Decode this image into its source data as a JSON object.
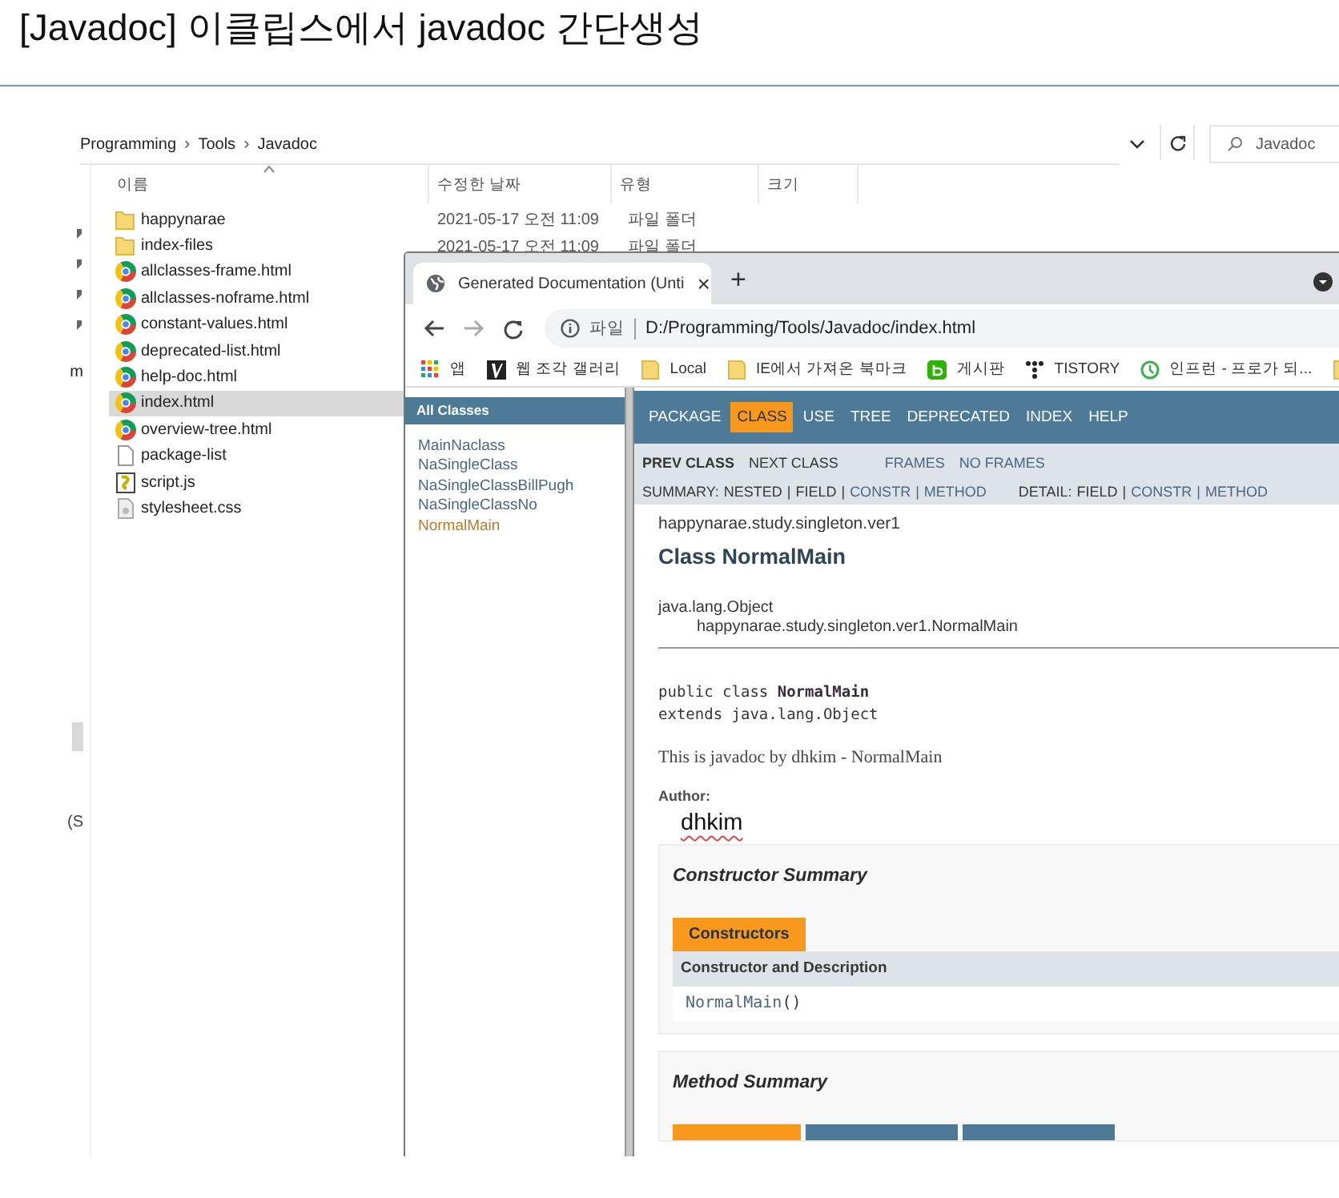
{
  "post_title": "[Javadoc] 이클립스에서 javadoc 간단생성",
  "explorer": {
    "breadcrumb": [
      "Programming",
      "Tools",
      "Javadoc"
    ],
    "breadcrumb_separator": "›",
    "search": {
      "placeholder": "Javadoc"
    },
    "nav_fragments": [
      "m",
      "(S"
    ],
    "columns": [
      "이름",
      "수정한 날짜",
      "유형",
      "크기"
    ],
    "files": [
      {
        "name": "happynarae",
        "kind": "folder",
        "modified": "2021-05-17 오전 11:09",
        "type": "파일 폴더",
        "selected": false
      },
      {
        "name": "index-files",
        "kind": "folder",
        "modified": "2021-05-17 오전 11:09",
        "type": "파일 폴더",
        "selected": false
      },
      {
        "name": "allclasses-frame.html",
        "kind": "chrome",
        "selected": false
      },
      {
        "name": "allclasses-noframe.html",
        "kind": "chrome",
        "selected": false
      },
      {
        "name": "constant-values.html",
        "kind": "chrome",
        "selected": false
      },
      {
        "name": "deprecated-list.html",
        "kind": "chrome",
        "selected": false
      },
      {
        "name": "help-doc.html",
        "kind": "chrome",
        "selected": false
      },
      {
        "name": "index.html",
        "kind": "chrome",
        "selected": true
      },
      {
        "name": "overview-tree.html",
        "kind": "chrome",
        "selected": false
      },
      {
        "name": "package-list",
        "kind": "file",
        "selected": false
      },
      {
        "name": "script.js",
        "kind": "script",
        "selected": false
      },
      {
        "name": "stylesheet.css",
        "kind": "css",
        "selected": false
      }
    ]
  },
  "browser": {
    "tab": {
      "title": "Generated Documentation (Unti",
      "close": "×"
    },
    "new_tab": "+",
    "address": {
      "scheme": "파일",
      "url": "D:/Programming/Tools/Javadoc/index.html"
    },
    "bookmarks": [
      {
        "label": "앱",
        "kind": "apps"
      },
      {
        "label": "웹 조각 갤러리",
        "kind": "gallery"
      },
      {
        "label": "Local",
        "kind": "folder"
      },
      {
        "label": "IE에서 가져온 북마크",
        "kind": "folder"
      },
      {
        "label": "게시판",
        "kind": "board"
      },
      {
        "label": "TISTORY",
        "kind": "tistory"
      },
      {
        "label": "인프런 - 프로가 되...",
        "kind": "clock"
      },
      {
        "kind": "folder"
      }
    ],
    "javadoc": {
      "all_classes": "All Classes",
      "classes": [
        {
          "name": "MainNaclass",
          "visited": false
        },
        {
          "name": "NaSingleClass",
          "visited": false
        },
        {
          "name": "NaSingleClassBillPugh",
          "visited": false
        },
        {
          "name": "NaSingleClassNo",
          "visited": false
        },
        {
          "name": "NormalMain",
          "visited": true
        }
      ],
      "nav": [
        {
          "label": "PACKAGE",
          "selected": false
        },
        {
          "label": "CLASS",
          "selected": true
        },
        {
          "label": "USE",
          "selected": false
        },
        {
          "label": "TREE",
          "selected": false
        },
        {
          "label": "DEPRECATED",
          "selected": false
        },
        {
          "label": "INDEX",
          "selected": false
        },
        {
          "label": "HELP",
          "selected": false
        }
      ],
      "subnav_links": [
        {
          "text": "PREV CLASS",
          "kind": "strong"
        },
        {
          "text": "NEXT CLASS",
          "kind": "plain"
        },
        {
          "text": "FRAMES",
          "kind": "link"
        },
        {
          "text": "NO FRAMES",
          "kind": "link"
        }
      ],
      "summary": [
        {
          "text": "SUMMARY:",
          "kind": "plain"
        },
        {
          "text": "NESTED",
          "kind": "plain"
        },
        {
          "text": "|",
          "kind": "plain"
        },
        {
          "text": "FIELD",
          "kind": "plain"
        },
        {
          "text": "|",
          "kind": "plain"
        },
        {
          "text": "CONSTR",
          "kind": "link"
        },
        {
          "text": "|",
          "kind": "link"
        },
        {
          "text": "METHOD",
          "kind": "link"
        }
      ],
      "detail": [
        {
          "text": "DETAIL:",
          "kind": "plain"
        },
        {
          "text": "FIELD",
          "kind": "plain"
        },
        {
          "text": "|",
          "kind": "plain"
        },
        {
          "text": "CONSTR",
          "kind": "link"
        },
        {
          "text": "|",
          "kind": "link"
        },
        {
          "text": "METHOD",
          "kind": "link"
        }
      ],
      "package": "happynarae.study.singleton.ver1",
      "class_title": "Class NormalMain",
      "inheritance": [
        "java.lang.Object",
        "happynarae.study.singleton.ver1.NormalMain"
      ],
      "signature": [
        "public class **NormalMain**",
        "extends java.lang.Object"
      ],
      "description": "This is javadoc by dhkim - NormalMain",
      "author_label": "Author:",
      "author": "dhkim",
      "constructor_summary": {
        "heading": "Constructor Summary",
        "tab": "Constructors",
        "column": "Constructor and Description",
        "rows": [
          {
            "name": "NormalMain",
            "params": "()"
          }
        ]
      },
      "method_summary": {
        "heading": "Method Summary",
        "tabs": [
          {
            "selected": true
          },
          {
            "selected": false
          },
          {
            "selected": false
          }
        ]
      }
    }
  }
}
